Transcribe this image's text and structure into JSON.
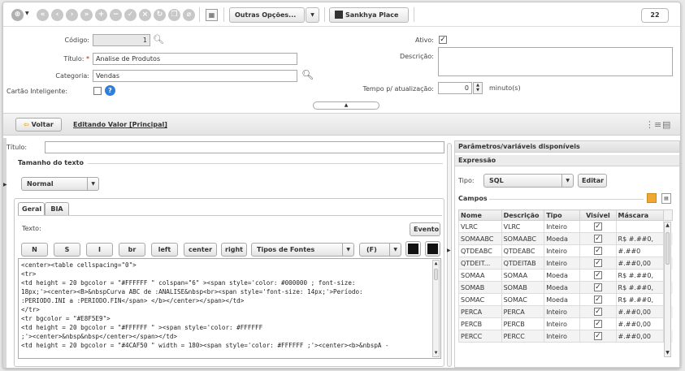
{
  "toolbar": {
    "outras_opcoes": "Outras Opções...",
    "sankhya_place": "Sankhya Place",
    "counter": "22"
  },
  "form": {
    "codigo_label": "Código:",
    "codigo_value": "1",
    "titulo_label": "Título:",
    "titulo_value": "Analise de Produtos",
    "categoria_label": "Categoria:",
    "categoria_value": "Vendas",
    "cartao_label": "Cartão Inteligente:",
    "ativo_label": "Ativo:",
    "descricao_label": "Descrição:",
    "tempo_label": "Tempo p/ atualização:",
    "tempo_value": "0",
    "tempo_unit": "minuto(s)"
  },
  "editor": {
    "voltar": "Voltar",
    "editando": "Editando Valor [Principal]",
    "titulo_label": "Título:",
    "tamanho_label": "Tamanho do texto",
    "tamanho_value": "Normal",
    "tabs": [
      "Geral",
      "BIA"
    ],
    "texto_label": "Texto:",
    "evento": "Evento",
    "fmt_buttons": [
      "N",
      "S",
      "I",
      "br",
      "left",
      "center",
      "right"
    ],
    "tipos_fontes": "Tipos de Fontes",
    "f_button": "(F)",
    "code_lines": [
      "<center><table cellspacing=\"0\">",
      "  <tr>",
      "     <td height = 20 bgcolor = \"#FFFFFF \" colspan=\"6\" ><span style='color: #000000 ; font-size:",
      "18px;'><center><B>&nbspCurva ABC de :ANALISE&nbsp<br><span style='font-size: 14px;'>Período:",
      ":PERIODO.INI a :PERIODO.FIN</span> </b></center></span></td>",
      "  </tr>",
      "  <tr bgcolor = \"#E8F5E9\">",
      "     <td height = 20 bgcolor = \"#FFFFFF \" ><span style='color: #FFFFFF",
      ";'><center>&nbsp&nbsp</center></span></td>",
      "     <td height = 20 bgcolor = \"#4CAF50 \" width = 180><span style='color: #FFFFFF ;'><center><b>&nbspA -"
    ]
  },
  "params": {
    "header": "Parâmetros/variáveis disponíveis",
    "expressao": "Expressão",
    "tipo_label": "Tipo:",
    "tipo_value": "SQL",
    "editar": "Editar",
    "campos": "Campos",
    "columns": [
      "Nome",
      "Descrição",
      "Tipo",
      "Visível",
      "Máscara"
    ],
    "rows": [
      [
        "VLRC",
        "VLRC",
        "Inteiro",
        true,
        ""
      ],
      [
        "SOMAABC",
        "SOMAABC",
        "Moeda",
        true,
        "R$ #.##0,"
      ],
      [
        "QTDEABC",
        "QTDEABC",
        "Inteiro",
        true,
        "#.##0"
      ],
      [
        "QTDEIT...",
        "QTDEITAB",
        "Inteiro",
        true,
        "#.##0,00"
      ],
      [
        "SOMAA",
        "SOMAA",
        "Moeda",
        true,
        "R$ #.##0,"
      ],
      [
        "SOMAB",
        "SOMAB",
        "Moeda",
        true,
        "R$ #.##0,"
      ],
      [
        "SOMAC",
        "SOMAC",
        "Moeda",
        true,
        "R$ #.##0,"
      ],
      [
        "PERCA",
        "PERCA",
        "Inteiro",
        true,
        "#.##0,00"
      ],
      [
        "PERCB",
        "PERCB",
        "Inteiro",
        true,
        "#.##0,00"
      ],
      [
        "PERCC",
        "PERCC",
        "Inteiro",
        true,
        "#.##0,00"
      ]
    ]
  }
}
